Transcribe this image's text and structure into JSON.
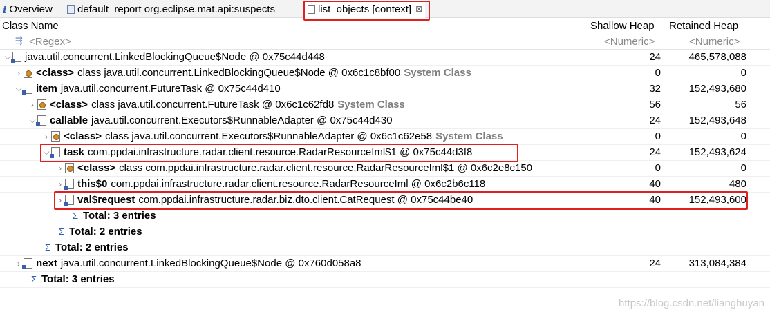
{
  "tabs": [
    {
      "label": "Overview",
      "icon": "info-icon"
    },
    {
      "label": "default_report  org.eclipse.mat.api:suspects",
      "icon": "report-icon"
    },
    {
      "label": "list_objects  [context]",
      "icon": "document-icon",
      "close": "⊠"
    }
  ],
  "columns": {
    "class_name": "Class Name",
    "shallow": "Shallow Heap",
    "retained": "Retained Heap"
  },
  "filter": {
    "regex": "<Regex>",
    "shallow": "<Numeric>",
    "retained": "<Numeric>"
  },
  "rows": [
    {
      "field": "",
      "text": "java.util.concurrent.LinkedBlockingQueue$Node @ 0x75c44d448",
      "sys": "",
      "shallow": "24",
      "retained": "465,578,088"
    },
    {
      "field": "<class>",
      "text": "class java.util.concurrent.LinkedBlockingQueue$Node @ 0x6c1c8bf00",
      "sys": "System Class",
      "shallow": "0",
      "retained": "0"
    },
    {
      "field": "item",
      "text": "java.util.concurrent.FutureTask @ 0x75c44d410",
      "sys": "",
      "shallow": "32",
      "retained": "152,493,680"
    },
    {
      "field": "<class>",
      "text": "class java.util.concurrent.FutureTask @ 0x6c1c62fd8",
      "sys": "System Class",
      "shallow": "56",
      "retained": "56"
    },
    {
      "field": "callable",
      "text": "java.util.concurrent.Executors$RunnableAdapter @ 0x75c44d430",
      "sys": "",
      "shallow": "24",
      "retained": "152,493,648"
    },
    {
      "field": "<class>",
      "text": "class java.util.concurrent.Executors$RunnableAdapter @ 0x6c1c62e58",
      "sys": "System Class",
      "shallow": "0",
      "retained": "0"
    },
    {
      "field": "task",
      "text": "com.ppdai.infrastructure.radar.client.resource.RadarResourceIml$1 @ 0x75c44d3f8",
      "sys": "",
      "shallow": "24",
      "retained": "152,493,624"
    },
    {
      "field": "<class>",
      "text": "class com.ppdai.infrastructure.radar.client.resource.RadarResourceIml$1 @ 0x6c2e8c150",
      "sys": "",
      "shallow": "0",
      "retained": "0"
    },
    {
      "field": "this$0",
      "text": "com.ppdai.infrastructure.radar.client.resource.RadarResourceIml @ 0x6c2b6c118",
      "sys": "",
      "shallow": "40",
      "retained": "480"
    },
    {
      "field": "val$request",
      "text": "com.ppdai.infrastructure.radar.biz.dto.client.CatRequest @ 0x75c44be40",
      "sys": "",
      "shallow": "40",
      "retained": "152,493,600"
    },
    {
      "total": "Total: 3 entries"
    },
    {
      "total": "Total: 2 entries"
    },
    {
      "total": "Total: 2 entries"
    },
    {
      "field": "next",
      "text": "java.util.concurrent.LinkedBlockingQueue$Node @ 0x760d058a8",
      "sys": "",
      "shallow": "24",
      "retained": "313,084,384"
    },
    {
      "total": "Total: 3 entries"
    }
  ],
  "watermark": "https://blog.csdn.net/lianghuyan",
  "highlight_color": "#e0201c"
}
